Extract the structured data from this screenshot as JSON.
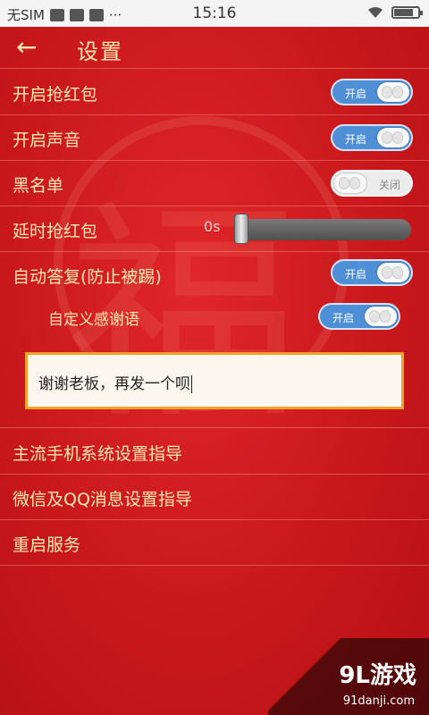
{
  "status_bar": {
    "carrier": "无SIM",
    "time": "15:16"
  },
  "header": {
    "back_icon": "arrow-left-icon",
    "title": "设置"
  },
  "settings": {
    "grab_red_packet": {
      "label": "开启抢红包",
      "state": "开启"
    },
    "sound": {
      "label": "开启声音",
      "state": "开启"
    },
    "blacklist": {
      "label": "黑名单",
      "state": "关闭"
    },
    "delay": {
      "label": "延时抢红包",
      "value": "0s",
      "slider_fraction": 0
    },
    "auto_reply": {
      "label": "自动答复(防止被踢)",
      "state": "开启"
    },
    "custom_thanks": {
      "label": "自定义感谢语",
      "state": "开启"
    },
    "thanks_text": "谢谢老板，再发一个呗"
  },
  "links": {
    "phone_guide": "主流手机系统设置指导",
    "wechat_qq_guide": "微信及QQ消息设置指导",
    "restart": "重启服务"
  },
  "watermark": {
    "brand": "9L游戏",
    "site": "91danji.com"
  },
  "colors": {
    "background": "#c9181c",
    "text": "#ffe8b0",
    "toggle_on": "#4e8fd6",
    "toggle_off": "#ececec",
    "input_border": "#f2a02c"
  }
}
